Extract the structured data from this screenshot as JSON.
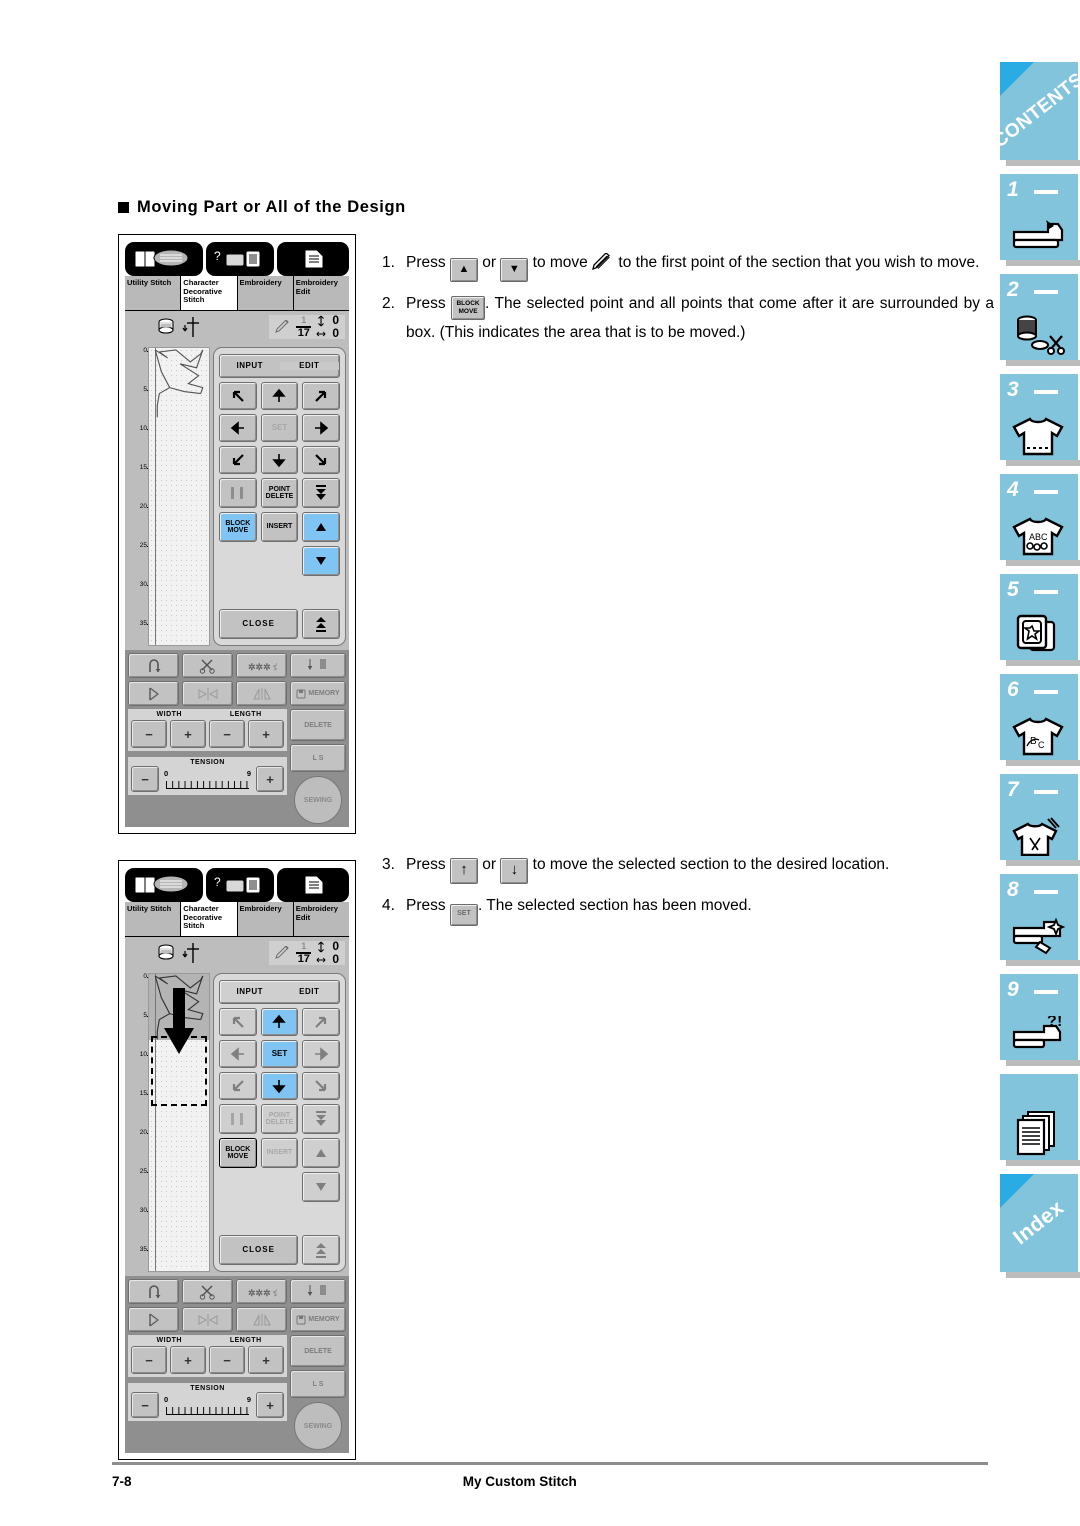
{
  "heading": "Moving Part or All of the Design",
  "footer": {
    "page_number": "7-8",
    "title": "My Custom Stitch"
  },
  "lcd": {
    "top_icons": [
      "manual-guide-icon",
      "help-machine-icon",
      "settings-list-icon"
    ],
    "tabs": [
      {
        "label": "Utility Stitch",
        "active": false
      },
      {
        "label": "Character Decorative Stitch",
        "active": true
      },
      {
        "label": "Embroidery",
        "active": false
      },
      {
        "label": "Embroidery Edit",
        "active": false
      }
    ],
    "counter": {
      "numerator": "1",
      "denominator": "17"
    },
    "offset_vertical": "0",
    "offset_horizontal": "0",
    "ruler_ticks": [
      "0",
      "5",
      "10",
      "15",
      "20",
      "25",
      "30",
      "35"
    ],
    "panel": {
      "input_label": "INPUT",
      "edit_label": "EDIT",
      "set_label": "SET",
      "point_delete_label": "POINT DELETE",
      "block_move_label": "BLOCK MOVE",
      "insert_label": "INSERT",
      "close_label": "CLOSE"
    },
    "toolbar": {
      "memory_label": "MEMORY",
      "delete_label": "DELETE",
      "ls_label": "L   S",
      "sewing_label": "SEWING",
      "width_label": "WIDTH",
      "length_label": "LENGTH",
      "tension_label": "TENSION",
      "tension_min": "0",
      "tension_max": "9",
      "minus": "−",
      "plus": "+"
    }
  },
  "screen1": {
    "caption": "edit-mode-block-move-selected",
    "edit_selected": true,
    "block_move_active": true
  },
  "screen2": {
    "caption": "section-moved-down",
    "edit_selected": false,
    "block_move_active": false
  },
  "steps_group1": [
    {
      "number": "1.",
      "parts": [
        {
          "t": "text",
          "v": "Press "
        },
        {
          "t": "key-up",
          "v": "▲"
        },
        {
          "t": "text",
          "v": " or "
        },
        {
          "t": "key-down",
          "v": "▼"
        },
        {
          "t": "text",
          "v": " to move "
        },
        {
          "t": "icon-pen",
          "v": "pen-icon"
        },
        {
          "t": "text",
          "v": " to the first point of the section that you wish to move."
        }
      ]
    },
    {
      "number": "2.",
      "parts": [
        {
          "t": "text",
          "v": "Press "
        },
        {
          "t": "key-block",
          "v": "BLOCK MOVE"
        },
        {
          "t": "text",
          "v": ". The selected point and all points that come after it are surrounded by a box. (This indicates the area that is to be moved.)"
        }
      ]
    }
  ],
  "steps_group2": [
    {
      "number": "3.",
      "parts": [
        {
          "t": "text",
          "v": "Press "
        },
        {
          "t": "key-bigup",
          "v": "↑"
        },
        {
          "t": "text",
          "v": " or "
        },
        {
          "t": "key-bigdown",
          "v": "↓"
        },
        {
          "t": "text",
          "v": " to move the selected section to the desired location."
        }
      ]
    },
    {
      "number": "4.",
      "parts": [
        {
          "t": "text",
          "v": "Press "
        },
        {
          "t": "key-set",
          "v": "SET"
        },
        {
          "t": "text",
          "v": ". The selected section has been moved."
        }
      ]
    }
  ],
  "sidebar": [
    {
      "type": "corner",
      "label": "CONTENTS",
      "icon": "contents-tab"
    },
    {
      "type": "num",
      "label": "1",
      "icon": "sewing-machine-icon"
    },
    {
      "type": "num",
      "label": "2",
      "icon": "spool-scissors-icon"
    },
    {
      "type": "num",
      "label": "3",
      "icon": "tshirt-stitch-icon"
    },
    {
      "type": "num",
      "label": "4",
      "icon": "tshirt-abc-icon"
    },
    {
      "type": "num",
      "label": "5",
      "icon": "embroidery-card-icon"
    },
    {
      "type": "num",
      "label": "6",
      "icon": "tshirt-letters-icon"
    },
    {
      "type": "num",
      "label": "7",
      "icon": "tshirt-tools-icon"
    },
    {
      "type": "num",
      "label": "8",
      "icon": "machine-clean-icon"
    },
    {
      "type": "num",
      "label": "9",
      "icon": "machine-question-icon"
    },
    {
      "type": "plain",
      "label": "",
      "icon": "pages-icon"
    },
    {
      "type": "corner",
      "label": "Index",
      "icon": "index-tab"
    }
  ],
  "colors": {
    "tab_blue": "#82c4dc",
    "fold_blue": "#29ace3",
    "highlight_blue": "#7fc4f2",
    "lcd_gray": "#bdbdbd",
    "toolbar_gray": "#8f8f8f"
  }
}
